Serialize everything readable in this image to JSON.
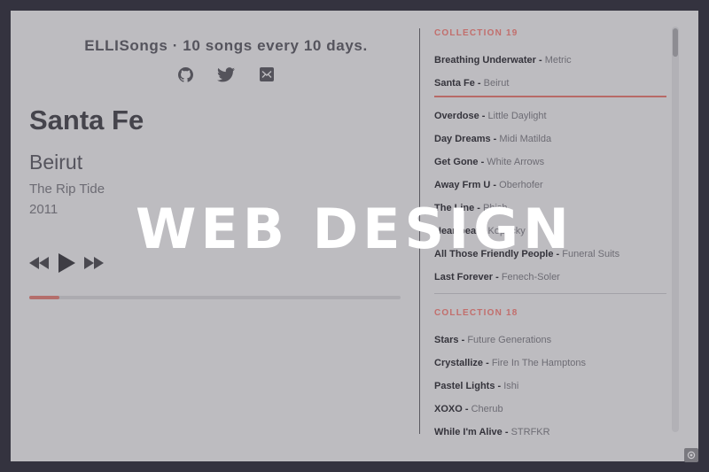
{
  "header": {
    "tagline": "ELLISongs · 10 songs every 10 days.",
    "icons": [
      "github-icon",
      "twitter-icon",
      "mail-icon"
    ]
  },
  "now_playing": {
    "title": "Santa Fe",
    "artist": "Beirut",
    "album": "The Rip Tide",
    "year": "2011",
    "progress_fraction": 0.08
  },
  "controls": [
    "rewind-icon",
    "play-icon",
    "fast-forward-icon"
  ],
  "playlist": {
    "collections": [
      {
        "title": "COLLECTION 19",
        "tracks": [
          {
            "title": "Breathing Underwater",
            "artist": "Metric"
          },
          {
            "title": "Santa Fe",
            "artist": "Beirut"
          },
          {
            "title": "Overdose",
            "artist": "Little Daylight"
          },
          {
            "title": "Day Dreams",
            "artist": "Midi Matilda"
          },
          {
            "title": "Get Gone",
            "artist": "White Arrows"
          },
          {
            "title": "Away Frm U",
            "artist": "Oberhofer"
          },
          {
            "title": "The Line",
            "artist": "Phish"
          },
          {
            "title": "Heartbeat",
            "artist": "Kopecky"
          },
          {
            "title": "All Those Friendly People",
            "artist": "Funeral Suits"
          },
          {
            "title": "Last Forever",
            "artist": "Fenech-Soler"
          }
        ]
      },
      {
        "title": "COLLECTION 18",
        "tracks": [
          {
            "title": "Stars",
            "artist": "Future Generations"
          },
          {
            "title": "Crystallize",
            "artist": "Fire In The Hamptons"
          },
          {
            "title": "Pastel Lights",
            "artist": "Ishi"
          },
          {
            "title": "XOXO",
            "artist": "Cherub"
          },
          {
            "title": "While I'm Alive",
            "artist": "STRFKR"
          }
        ]
      }
    ],
    "active_track": "Santa Fe"
  },
  "overlay": {
    "text": "WEB DESIGN"
  },
  "colors": {
    "accent": "#c26e6c",
    "background": "#34333f",
    "panel": "#bdbcc0"
  }
}
